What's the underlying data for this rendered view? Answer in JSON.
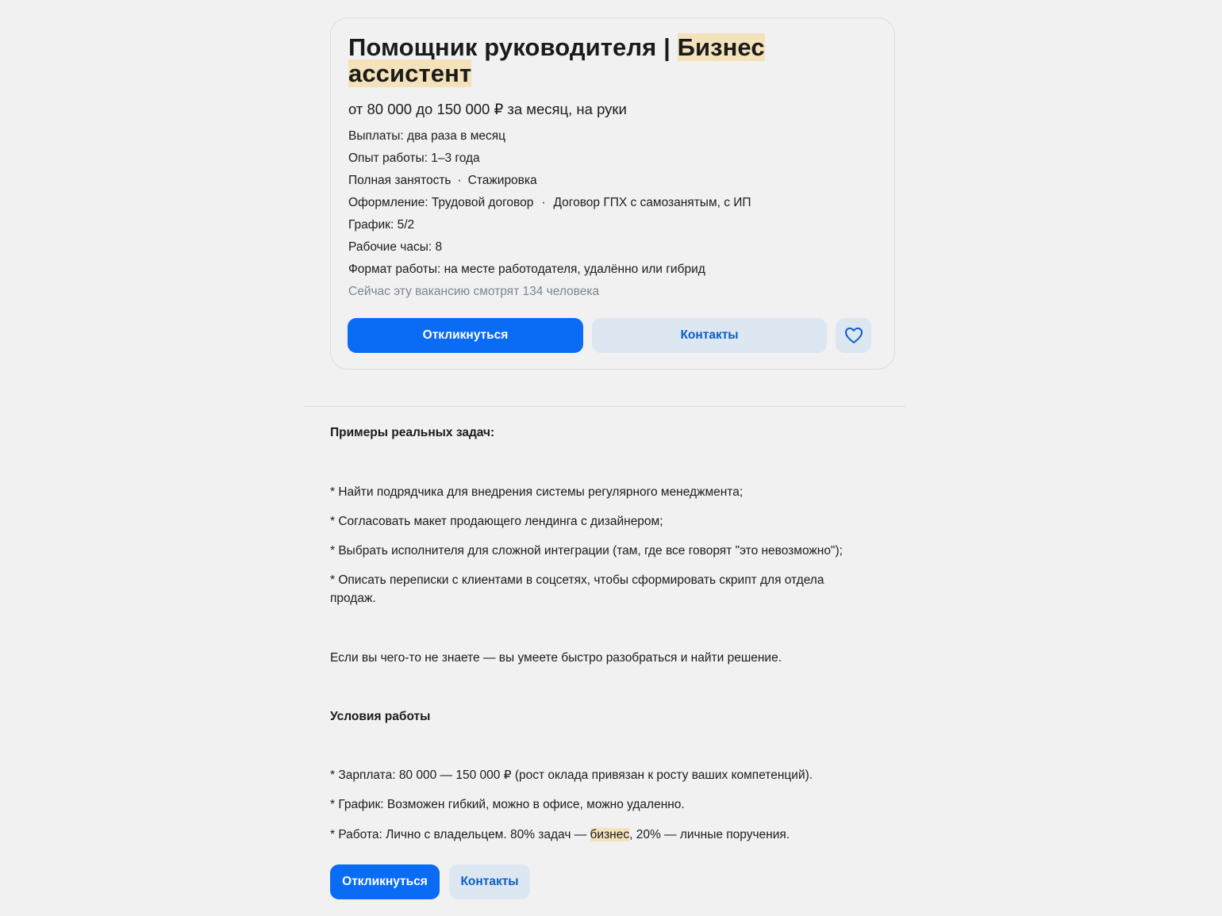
{
  "vacancy": {
    "title_part1": "Помощник руководителя | ",
    "title_highlight1": "Бизнес",
    "title_highlight2": "ассистент",
    "salary": "от 80 000 до 150 000 ₽ за месяц, на руки",
    "payouts": "Выплаты: два раза в месяц",
    "experience": "Опыт работы: 1–3 года",
    "employment_1": "Полная занятость",
    "employment_2": "Стажировка",
    "registration_1": "Оформление: Трудовой договор",
    "registration_2": "Договор ГПХ с самозанятым, с ИП",
    "schedule": "График: 5/2",
    "hours": "Рабочие часы: 8",
    "work_format": "Формат работы: на месте работодателя, удалённо или гибрид",
    "viewers": "Сейчас эту вакансию смотрят 134 человека",
    "separator": "·"
  },
  "actions": {
    "apply_label": "Откликнуться",
    "contacts_label": "Контакты",
    "favorite_icon": "heart-icon"
  },
  "description": {
    "tasks_heading": "Примеры реальных задач:",
    "task_1": "* Найти подрядчика для внедрения системы регулярного менеджмента;",
    "task_2": "* Согласовать макет продающего лендинга с дизайнером;",
    "task_3": "* Выбрать исполнителя для сложной интеграции (там, где все говорят \"это невозможно\");",
    "task_4": "* Описать переписки с клиентами в соцсетях, чтобы сформировать скрипт для отдела продаж.",
    "solve_note": "Если вы чего-то не знаете — вы умеете быстро разобраться и найти решение.",
    "conditions_heading": "Условия работы",
    "condition_1": "* Зарплата: 80 000 — 150 000 ₽ (рост оклада привязан к росту ваших компетенций).",
    "condition_2": "* График: Возможен гибкий, можно в офисе, можно удаленно.",
    "condition_3_before": "* Работа: Лично с владельцем. 80% задач — ",
    "condition_3_highlight": "бизнес",
    "condition_3_after": ", 20% — личные поручения."
  },
  "colors": {
    "primary": "#0a6cf5",
    "secondary_bg": "#dde7f1",
    "highlight": "#f4e2bb",
    "muted_text": "#7b8594"
  }
}
